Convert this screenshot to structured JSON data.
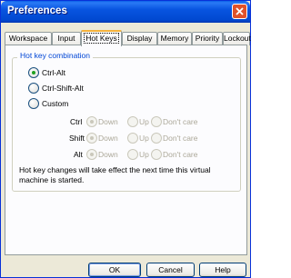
{
  "window": {
    "title": "Preferences"
  },
  "tabs": [
    "Workspace",
    "Input",
    "Hot Keys",
    "Display",
    "Memory",
    "Priority",
    "Lockout"
  ],
  "active_tab": "Hot Keys",
  "hotkeys": {
    "group_title": "Hot key combination",
    "options": [
      "Ctrl-Alt",
      "Ctrl-Shift-Alt",
      "Custom"
    ],
    "selected": "Ctrl-Alt",
    "modifiers": [
      {
        "label": "Ctrl",
        "choice": "Down"
      },
      {
        "label": "Shift",
        "choice": "Down"
      },
      {
        "label": "Alt",
        "choice": "Down"
      }
    ],
    "choices": [
      "Down",
      "Up",
      "Don't care"
    ],
    "note": "Hot key changes will take effect the next time this virtual machine is started."
  },
  "buttons": {
    "ok": "OK",
    "cancel": "Cancel",
    "help": "Help"
  },
  "colors": {
    "title_bar": "#0148d0",
    "group_title": "#0046d5",
    "selected_radio": "#21a121",
    "active_tab_accent": "#f5b23c"
  }
}
